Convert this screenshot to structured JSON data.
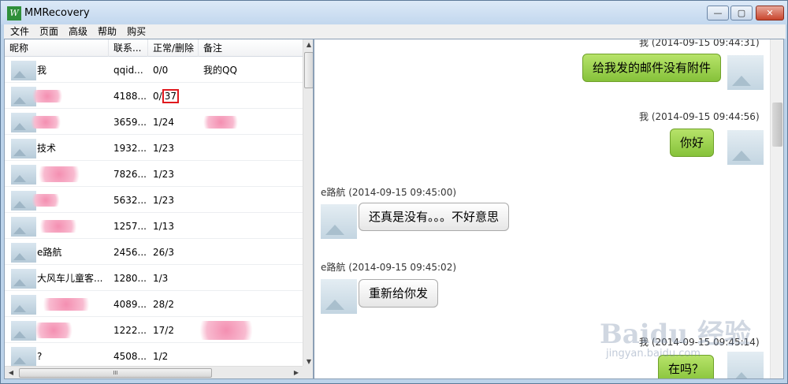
{
  "window": {
    "title": "MMRecovery",
    "icon_label": "W"
  },
  "controls": {
    "minimize": "—",
    "maximize": "▢",
    "close": "✕"
  },
  "menu": [
    "文件",
    "页面",
    "高级",
    "帮助",
    "购买"
  ],
  "table": {
    "headers": [
      "昵称",
      "联系...",
      "正常/删除",
      "备注"
    ],
    "rows": [
      {
        "name": "我",
        "id": "qqid...",
        "counts": "0/0",
        "note": "我的QQ"
      },
      {
        "name": "",
        "id": "4188...",
        "counts_a": "0/",
        "counts_b": "37",
        "note": ""
      },
      {
        "name": "",
        "id": "3659...",
        "counts": "1/24",
        "note": ""
      },
      {
        "name": "技术",
        "id": "1932...",
        "counts": "1/23",
        "note": ""
      },
      {
        "name": "",
        "id": "7826...",
        "counts": "1/23",
        "note": ""
      },
      {
        "name": "",
        "id": "5632...",
        "counts": "1/23",
        "note": ""
      },
      {
        "name": "",
        "id": "1257...",
        "counts": "1/13",
        "note": ""
      },
      {
        "name": "e路航",
        "id": "2456...",
        "counts": "26/3",
        "note": ""
      },
      {
        "name": "大风车儿童客...",
        "id": "1280...",
        "counts": "1/3",
        "note": ""
      },
      {
        "name": "",
        "id": "4089...",
        "counts": "28/2",
        "note": ""
      },
      {
        "name": "",
        "id": "1222...",
        "counts": "17/2",
        "note": ""
      },
      {
        "name": "?",
        "id": "4508...",
        "counts": "1/2",
        "note": ""
      }
    ],
    "hscroll_grip": "III"
  },
  "chat": {
    "messages": [
      {
        "stamp": "我 (2014-09-15 09:44:31)",
        "text": "给我发的邮件没有附件",
        "side": "right"
      },
      {
        "stamp": "我 (2014-09-15 09:44:56)",
        "text": "你好",
        "side": "right"
      },
      {
        "stamp": "e路航 (2014-09-15 09:45:00)",
        "text": "还真是没有。。。不好意思",
        "side": "left"
      },
      {
        "stamp": "e路航 (2014-09-15 09:45:02)",
        "text": "重新给你发",
        "side": "left"
      },
      {
        "stamp": "我 (2014-09-15 09:45:14)",
        "text": "在吗？",
        "side": "right"
      }
    ]
  },
  "watermark": {
    "brand": "Baidu 经验",
    "url": "jingyan.baidu.com"
  },
  "colors": {
    "bubble_green": "#9fd24f",
    "highlight_red": "#e0191e",
    "redact_pink": "#f48fb1"
  }
}
